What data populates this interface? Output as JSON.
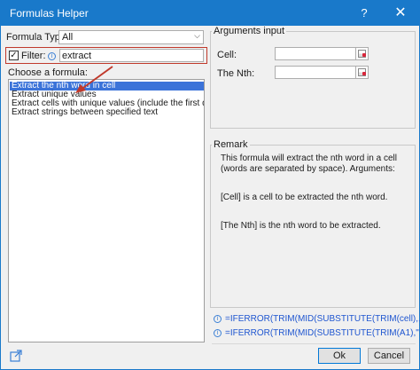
{
  "window": {
    "title": "Formulas Helper",
    "help_glyph": "?",
    "close_glyph": "✕"
  },
  "left": {
    "formula_type_label": "Formula Type:",
    "formula_type_value": "All",
    "filter_label": "Filter:",
    "filter_checked": "✓",
    "filter_value": "extract",
    "choose_label": "Choose a formula:",
    "items": [
      "Extract the nth word in cell",
      "Extract unique values",
      "Extract cells with unique values (include the first duplicate)",
      "Extract strings between specified text"
    ]
  },
  "arguments": {
    "group_title": "Arguments input",
    "cell_label": "Cell:",
    "nth_label": "The Nth:"
  },
  "remark": {
    "group_title": "Remark",
    "description": "This formula will extract the nth word in a cell (words are separated by space). Arguments:",
    "cell_note": "[Cell] is a cell to be extracted the nth word.",
    "nth_note": "[The Nth] is the nth word to be extracted."
  },
  "formulas": [
    "=IFERROR(TRIM(MID(SUBSTITUTE(TRIM(cell),...",
    "=IFERROR(TRIM(MID(SUBSTITUTE(TRIM(A1),\" ..."
  ],
  "buttons": {
    "ok": "Ok",
    "cancel": "Cancel"
  },
  "colors": {
    "titlebar": "#1979ca",
    "selection": "#3b73d9",
    "annotation_red": "#c0392b",
    "formula_blue": "#1f56d0"
  },
  "icons": [
    "question-icon",
    "close-icon",
    "chevron-down-icon",
    "info-icon",
    "range-select-icon",
    "share-icon"
  ]
}
